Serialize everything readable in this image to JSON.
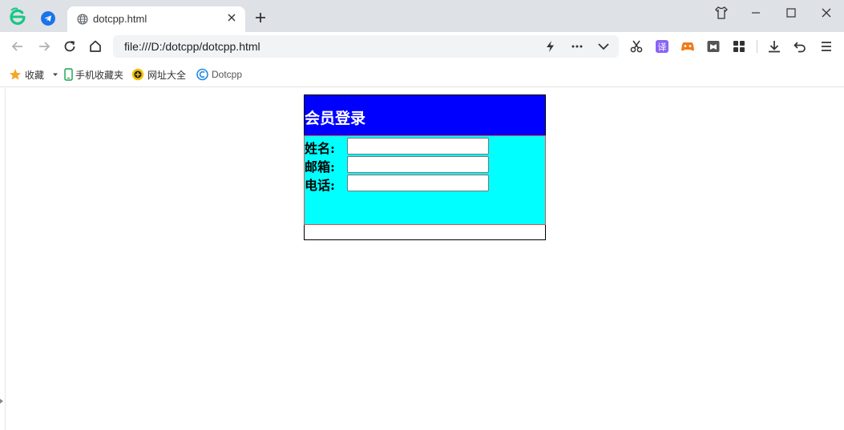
{
  "browser": {
    "tab": {
      "title": "dotcpp.html"
    },
    "address": {
      "url": "file:///D:/dotcpp/dotcpp.html"
    },
    "bookmarks": [
      {
        "label": "收藏",
        "icon": "star-icon"
      },
      {
        "label": "手机收藏夹",
        "icon": "phone-icon"
      },
      {
        "label": "网址大全",
        "icon": "web-directory-icon"
      },
      {
        "label": "Dotcpp",
        "icon": "dotcpp-logo-icon"
      }
    ],
    "colors": {
      "tabstrip": "#dee1e6",
      "logo": "#16c784",
      "star": "#f5a623"
    }
  },
  "page": {
    "login": {
      "heading": "会员登录",
      "fields": [
        {
          "label": "姓名:",
          "value": ""
        },
        {
          "label": "邮箱:",
          "value": ""
        },
        {
          "label": "电话:",
          "value": ""
        }
      ],
      "colors": {
        "header": "#0000ff",
        "body": "#00ffff",
        "body_border": "#d9534f"
      }
    }
  }
}
